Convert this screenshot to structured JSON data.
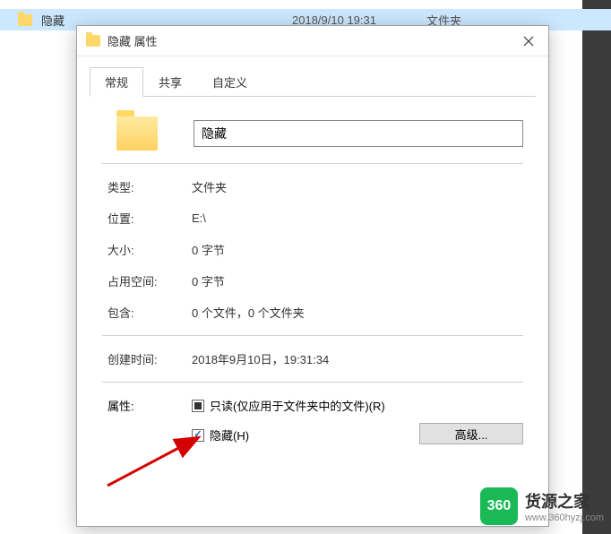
{
  "explorer_row": {
    "name": "隐藏",
    "date": "2018/9/10 19:31",
    "type": "文件夹"
  },
  "dialog": {
    "title": "隐藏 属性",
    "tabs": {
      "general": "常规",
      "sharing": "共享",
      "customize": "自定义"
    },
    "name_value": "隐藏",
    "fields": {
      "type_label": "类型:",
      "type_value": "文件夹",
      "location_label": "位置:",
      "location_value": "E:\\",
      "size_label": "大小:",
      "size_value": "0 字节",
      "sizeondisk_label": "占用空间:",
      "sizeondisk_value": "0 字节",
      "contains_label": "包含:",
      "contains_value": "0 个文件，0 个文件夹",
      "created_label": "创建时间:",
      "created_value": "2018年9月10日，19:31:34",
      "attributes_label": "属性:",
      "readonly_label": "只读(仅应用于文件夹中的文件)(R)",
      "hidden_label": "隐藏(H)",
      "advanced_label": "高级..."
    }
  },
  "watermark": {
    "badge": "360",
    "line1": "货源之家",
    "line2": "www.360hyzj.com"
  }
}
